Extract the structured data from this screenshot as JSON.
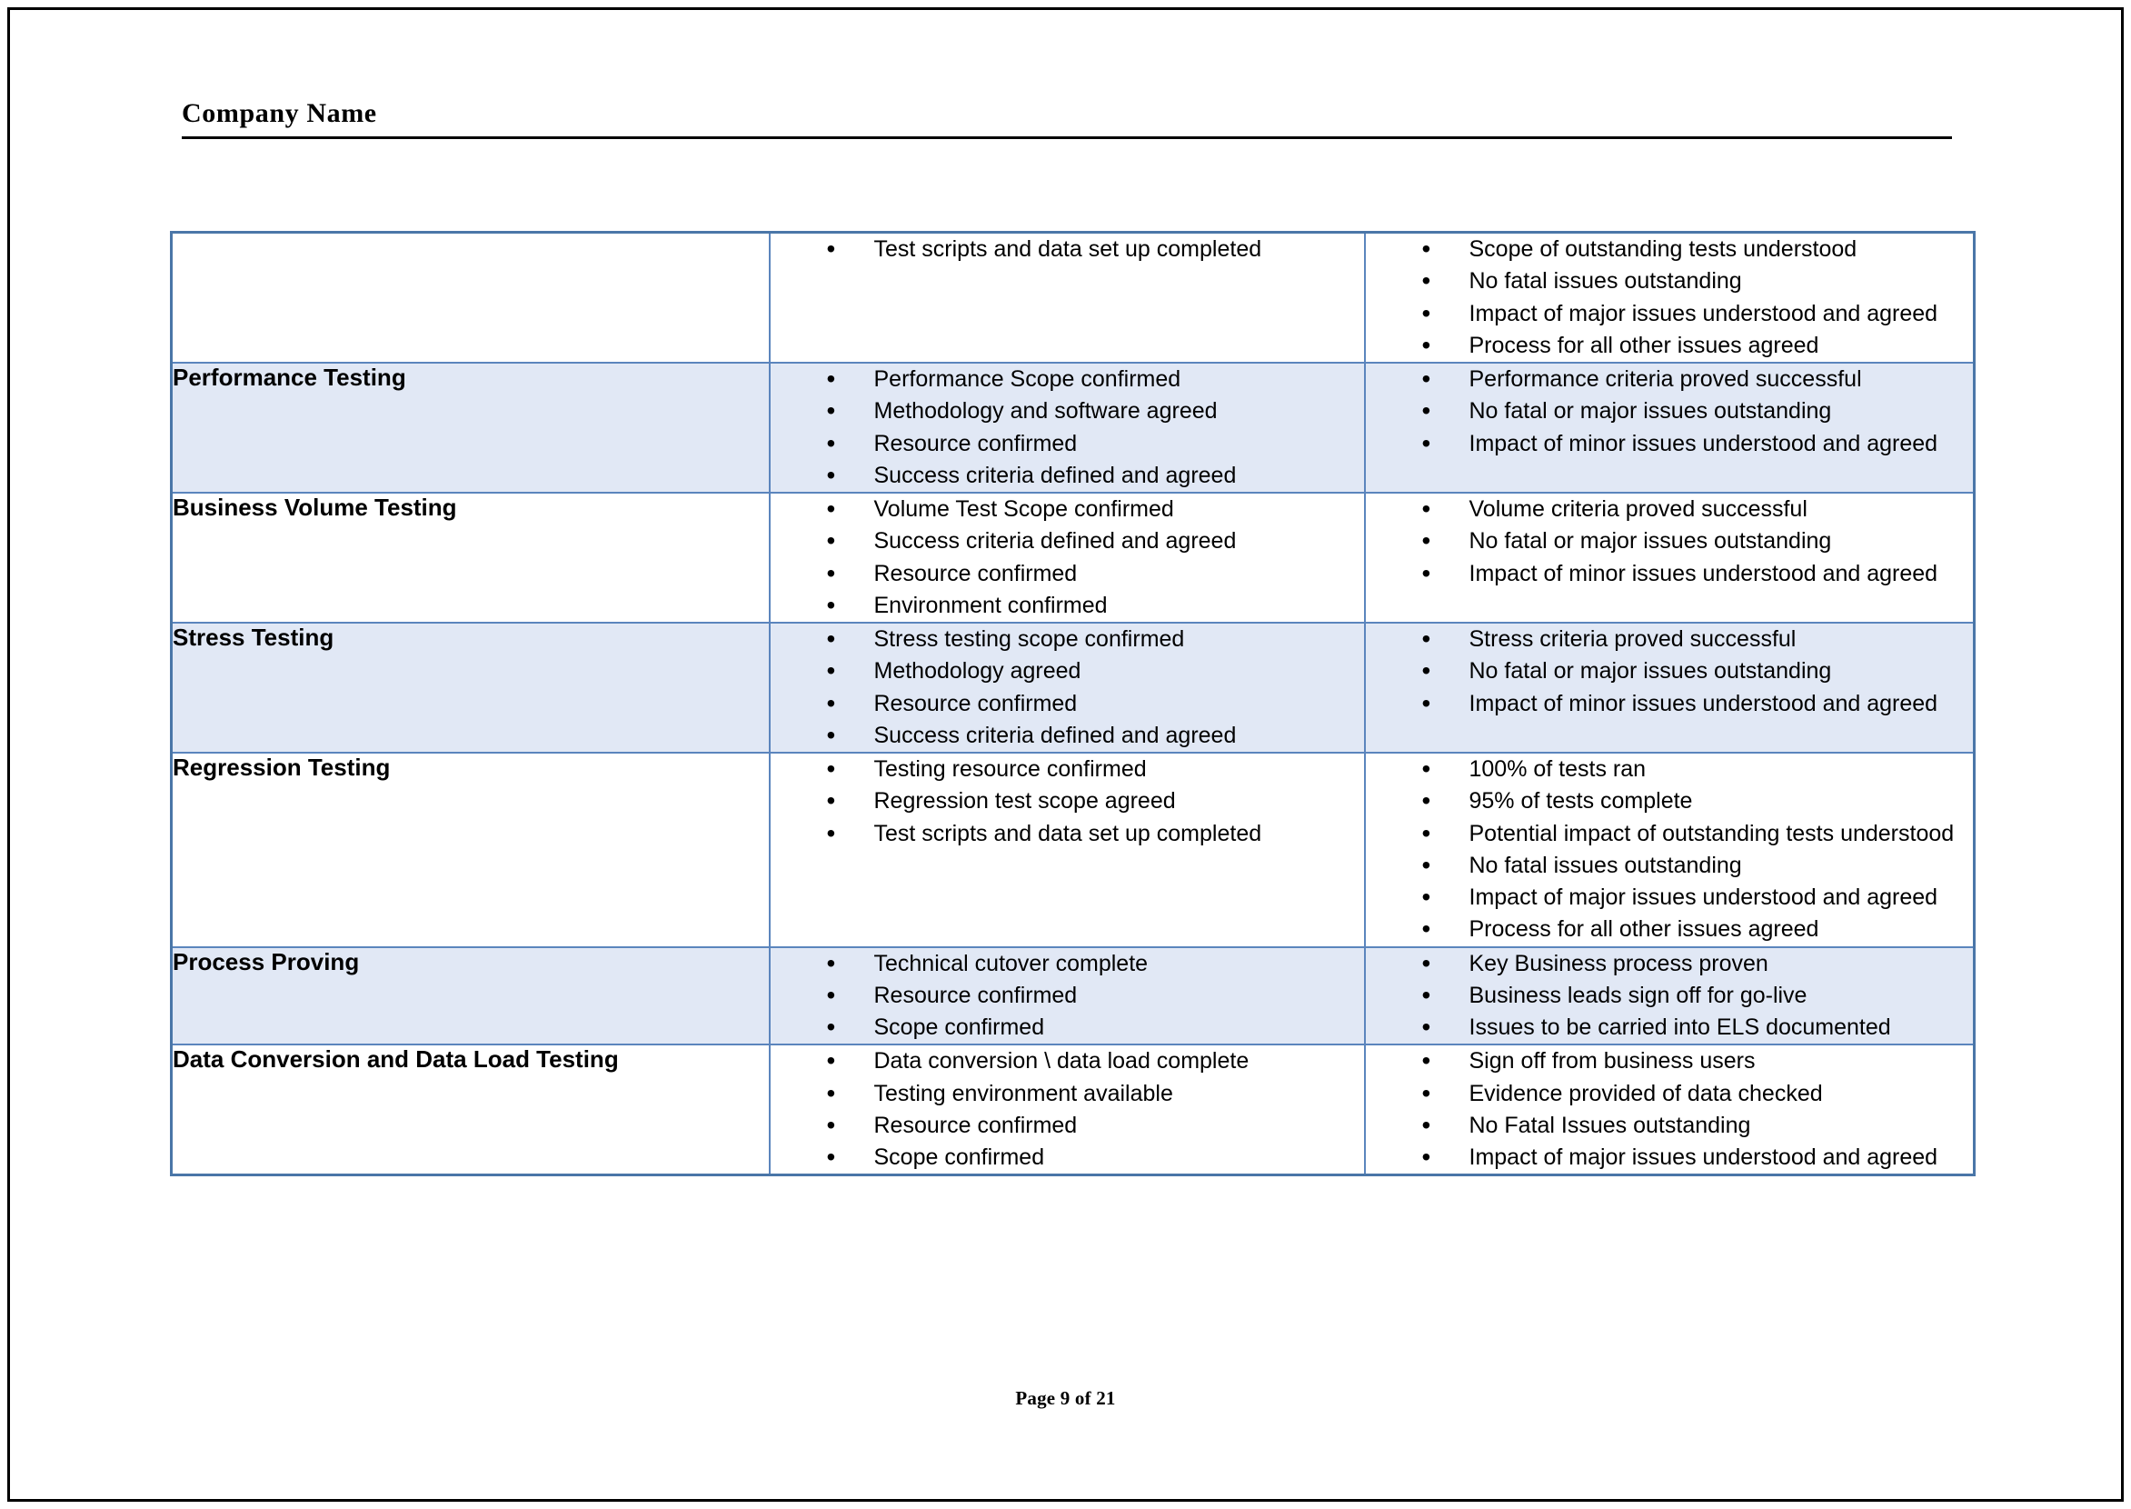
{
  "document": {
    "header_title": "Company Name",
    "footer_text": "Page 9 of 21",
    "colors": {
      "table_border": "#4a76a8",
      "cell_border": "#5b85bd",
      "row_shading": "#e1e8f5",
      "page_border": "#000000",
      "text": "#000000"
    }
  },
  "table": {
    "rows": [
      {
        "phase": "",
        "shaded": false,
        "entry_criteria": [
          "Test scripts and data set up completed"
        ],
        "exit_criteria": [
          "Scope of outstanding tests understood",
          "No fatal issues outstanding",
          "Impact of major issues understood and agreed",
          "Process for all other issues agreed"
        ]
      },
      {
        "phase": "Performance Testing",
        "shaded": true,
        "entry_criteria": [
          "Performance Scope confirmed",
          "Methodology and software agreed",
          "Resource confirmed",
          "Success criteria defined and agreed"
        ],
        "exit_criteria": [
          "Performance criteria proved successful",
          "No fatal or major issues outstanding",
          "Impact of minor issues understood and agreed"
        ]
      },
      {
        "phase": "Business Volume Testing",
        "shaded": false,
        "entry_criteria": [
          "Volume Test Scope confirmed",
          "Success criteria defined and agreed",
          "Resource confirmed",
          "Environment confirmed"
        ],
        "exit_criteria": [
          "Volume criteria proved successful",
          "No fatal or major issues outstanding",
          "Impact of minor issues understood and agreed"
        ]
      },
      {
        "phase": "Stress Testing",
        "shaded": true,
        "entry_criteria": [
          "Stress testing scope confirmed",
          "Methodology agreed",
          "Resource confirmed",
          "Success criteria defined and agreed"
        ],
        "exit_criteria": [
          "Stress criteria proved successful",
          "No fatal or major issues outstanding",
          "Impact of minor issues understood and agreed"
        ]
      },
      {
        "phase": "Regression Testing",
        "shaded": false,
        "entry_criteria": [
          "Testing resource confirmed",
          "Regression test scope agreed",
          "Test scripts and data set up completed"
        ],
        "exit_criteria": [
          "100% of tests ran",
          "95% of tests complete",
          "Potential impact of outstanding tests understood",
          "No fatal issues outstanding",
          "Impact of major issues understood and agreed",
          "Process for all other issues agreed"
        ]
      },
      {
        "phase": "Process Proving",
        "shaded": true,
        "entry_criteria": [
          "Technical cutover complete",
          "Resource confirmed",
          "Scope confirmed"
        ],
        "exit_criteria": [
          "Key Business process proven",
          "Business leads sign off for go-live",
          "Issues to be carried into ELS documented"
        ]
      },
      {
        "phase": "Data Conversion and Data Load Testing",
        "shaded": false,
        "entry_criteria": [
          "Data conversion \\ data load complete",
          "Testing environment available",
          "Resource confirmed",
          "Scope confirmed"
        ],
        "exit_criteria": [
          "Sign off from business users",
          "Evidence provided of data checked",
          "No Fatal Issues outstanding",
          "Impact of major issues understood and agreed"
        ]
      }
    ]
  }
}
